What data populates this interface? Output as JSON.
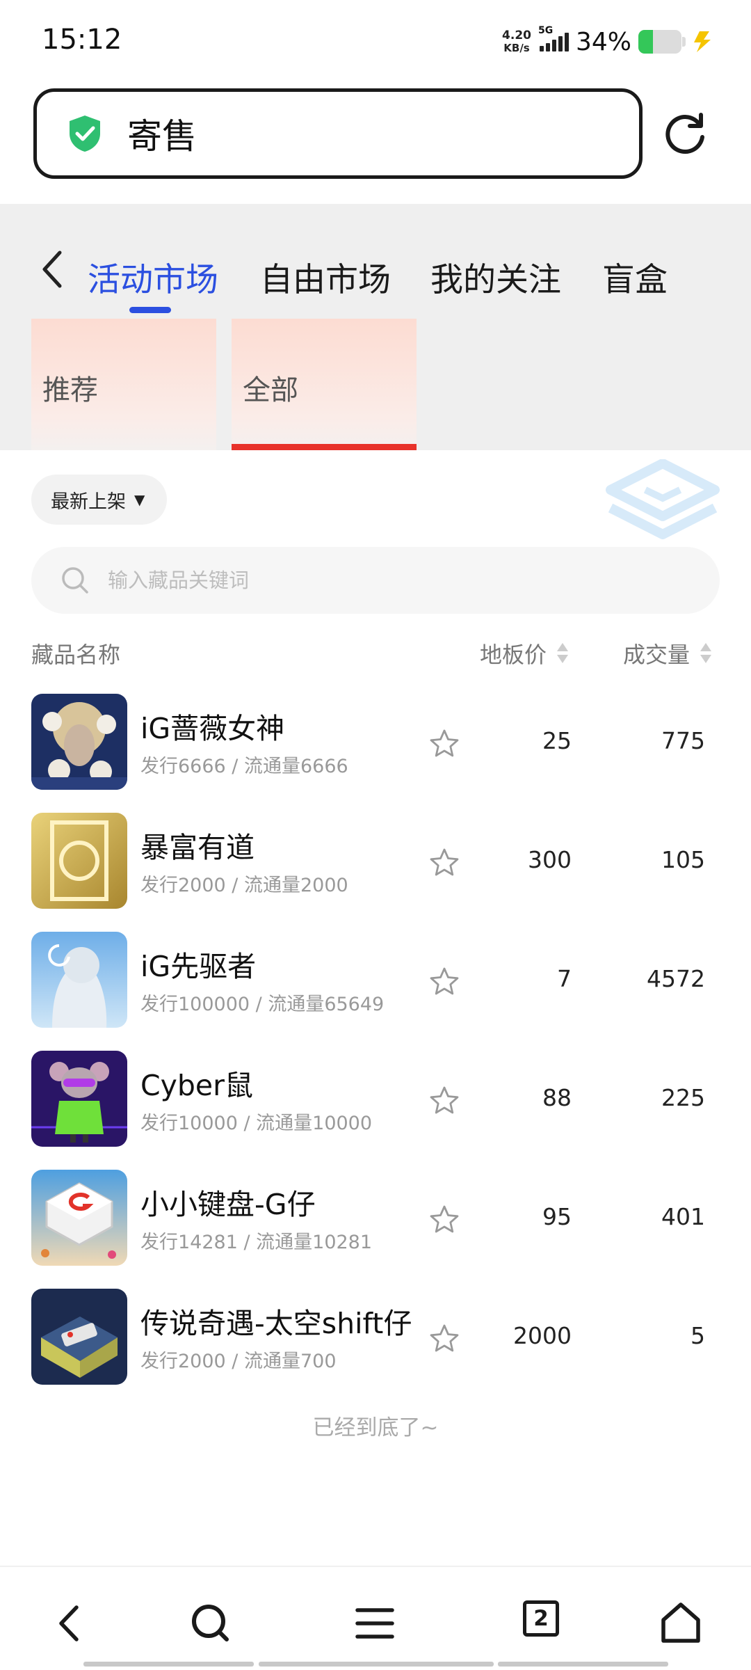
{
  "status": {
    "time": "15:12",
    "net_speed_value": "4.20",
    "net_speed_unit": "KB/s",
    "network": "5G",
    "battery_percent": "34%",
    "battery_level": 0.34,
    "charging_color": "#f5c400",
    "battery_color": "#34c759"
  },
  "urlbar": {
    "title": "寄售",
    "secure_icon": "shield-check-icon",
    "reload_icon": "reload-icon"
  },
  "tabs": [
    {
      "label": "活动市场",
      "active": true
    },
    {
      "label": "自由市场",
      "active": false
    },
    {
      "label": "我的关注",
      "active": false
    },
    {
      "label": "盲盒",
      "active": false
    }
  ],
  "categories": [
    {
      "label": "推荐",
      "active": false
    },
    {
      "label": "全部",
      "active": true
    }
  ],
  "sort": {
    "label": "最新上架",
    "caret": "▼"
  },
  "search": {
    "placeholder": "输入藏品关键词"
  },
  "columns": {
    "name": "藏品名称",
    "price": "地板价",
    "volume": "成交量"
  },
  "items": [
    {
      "name": "iG蔷薇女神",
      "sub": "发行6666 / 流通量6666",
      "price": "25",
      "volume": "775"
    },
    {
      "name": "暴富有道",
      "sub": "发行2000 / 流通量2000",
      "price": "300",
      "volume": "105"
    },
    {
      "name": "iG先驱者",
      "sub": "发行100000 / 流通量65649",
      "price": "7",
      "volume": "4572"
    },
    {
      "name": "Cyber鼠",
      "sub": "发行10000 / 流通量10000",
      "price": "88",
      "volume": "225"
    },
    {
      "name": "小小键盘-G仔",
      "sub": "发行14281 / 流通量10281",
      "price": "95",
      "volume": "401"
    },
    {
      "name": "传说奇遇-太空shift仔",
      "sub": "发行2000 / 流通量700",
      "price": "2000",
      "volume": "5"
    }
  ],
  "end_note": "已经到底了~",
  "bottom_nav": {
    "tab_count": "2"
  },
  "colors": {
    "accent": "#2b4fe0",
    "category_active_bar": "#e8322a"
  }
}
